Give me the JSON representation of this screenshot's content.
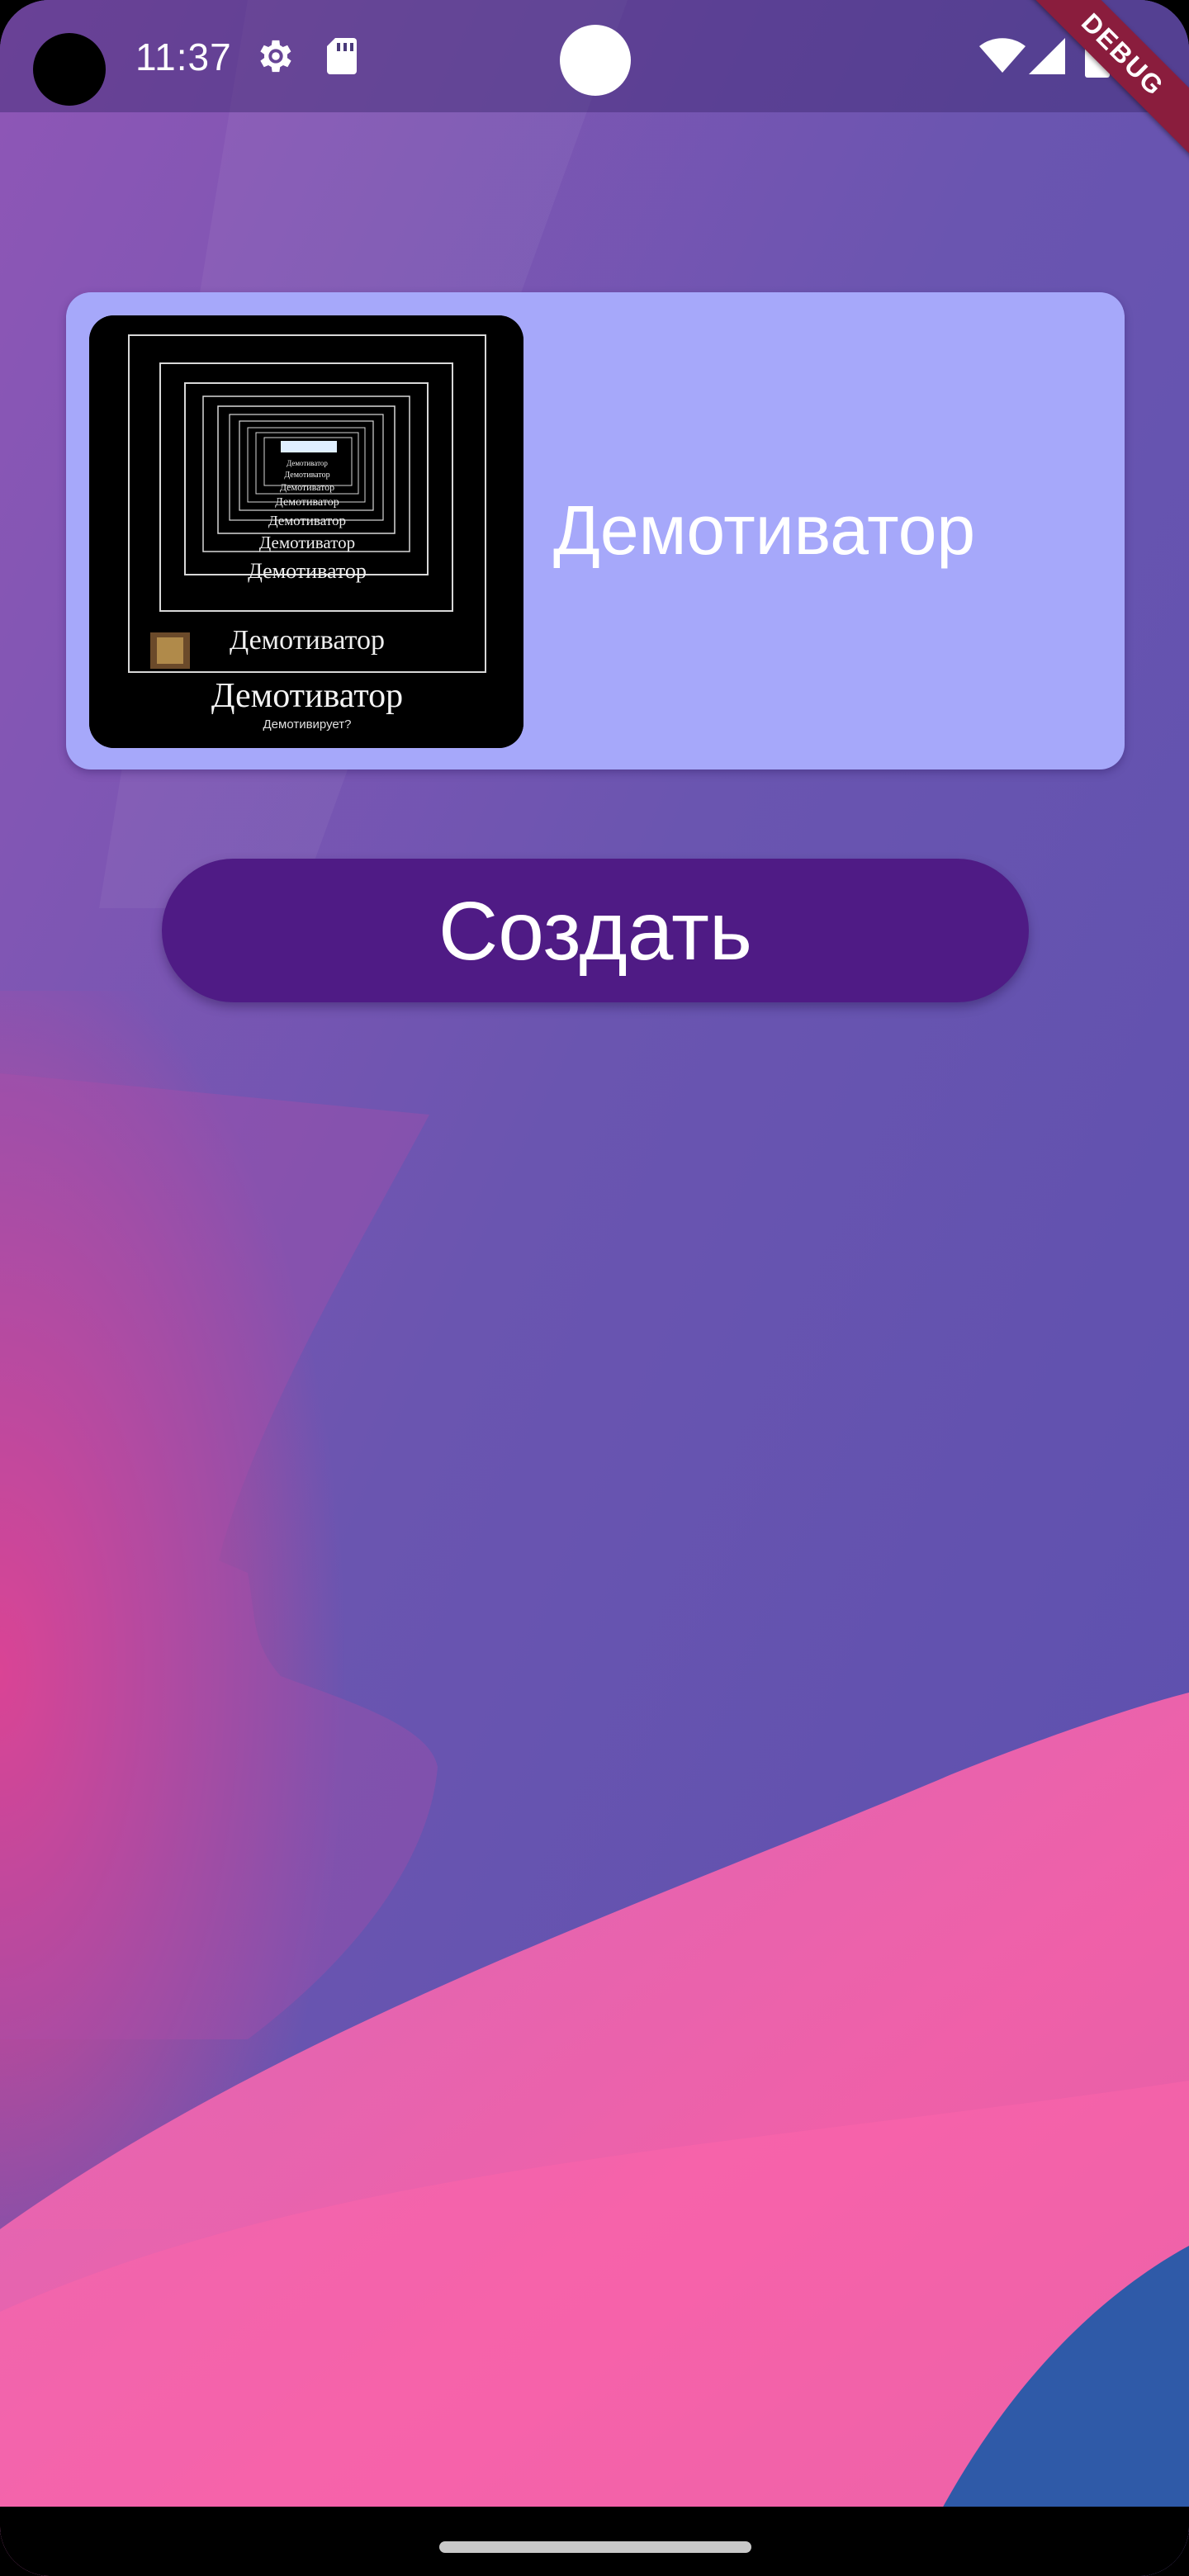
{
  "status_bar": {
    "time": "11:37",
    "icons": [
      "camera-hole",
      "settings-gear-icon",
      "sd-card-icon",
      "wifi-icon",
      "cellular-signal-icon",
      "battery-icon"
    ],
    "debug_label": "DEBUG"
  },
  "card": {
    "title": "Демотиватор",
    "thumbnail": {
      "nested_captions": [
        "Демотиватор",
        "Демотиватор",
        "Демотиватор",
        "Демотиватор",
        "Демотиватор",
        "Демотиватор",
        "Демотиватор"
      ],
      "bottom_caption": "Демотиватор",
      "bottom_subcaption": "Демотивирует?"
    }
  },
  "create_button": {
    "label": "Создать"
  },
  "colors": {
    "card_background": "#a6a8fa",
    "button_background": "#4f1b85",
    "text": "#ffffff"
  }
}
